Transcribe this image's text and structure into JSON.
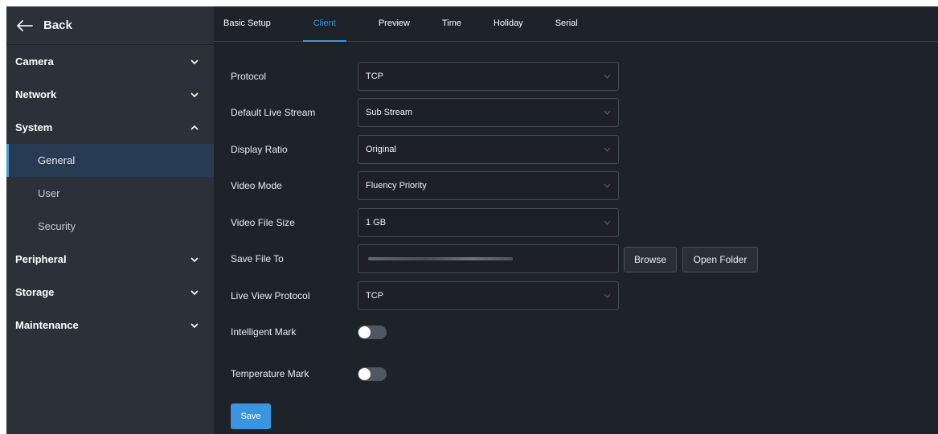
{
  "sidebar": {
    "back_label": "Back",
    "items": [
      {
        "label": "Camera",
        "icon": "chevron-down-icon"
      },
      {
        "label": "Network",
        "icon": "chevron-down-icon"
      },
      {
        "label": "System",
        "icon": "chevron-up-icon"
      },
      {
        "label": "Peripheral",
        "icon": "chevron-down-icon"
      },
      {
        "label": "Storage",
        "icon": "chevron-down-icon"
      },
      {
        "label": "Maintenance",
        "icon": "chevron-down-icon"
      }
    ],
    "system_sub": [
      {
        "label": "General",
        "active": true
      },
      {
        "label": "User",
        "active": false
      },
      {
        "label": "Security",
        "active": false
      }
    ]
  },
  "tabs": [
    {
      "label": "Basic Setup",
      "active": false
    },
    {
      "label": "Client",
      "active": true
    },
    {
      "label": "Preview",
      "active": false
    },
    {
      "label": "Time",
      "active": false
    },
    {
      "label": "Holiday",
      "active": false
    },
    {
      "label": "Serial",
      "active": false
    }
  ],
  "form": {
    "protocol": {
      "label": "Protocol",
      "value": "TCP"
    },
    "default_live_stream": {
      "label": "Default Live Stream",
      "value": "Sub Stream"
    },
    "display_ratio": {
      "label": "Display Ratio",
      "value": "Original"
    },
    "video_mode": {
      "label": "Video Mode",
      "value": "Fluency Priority"
    },
    "video_file_size": {
      "label": "Video File Size",
      "value": "1 GB"
    },
    "save_file_to": {
      "label": "Save File To",
      "browse_label": "Browse",
      "open_folder_label": "Open Folder"
    },
    "live_view_protocol": {
      "label": "Live View Protocol",
      "value": "TCP"
    },
    "intelligent_mark": {
      "label": "Intelligent Mark",
      "enabled": false
    },
    "temperature_mark": {
      "label": "Temperature Mark",
      "enabled": false
    }
  },
  "save_label": "Save",
  "colors": {
    "accent": "#3d97e0",
    "sidebar": "#2b3039",
    "main": "#1e2229",
    "active_nav": "#273b52"
  }
}
